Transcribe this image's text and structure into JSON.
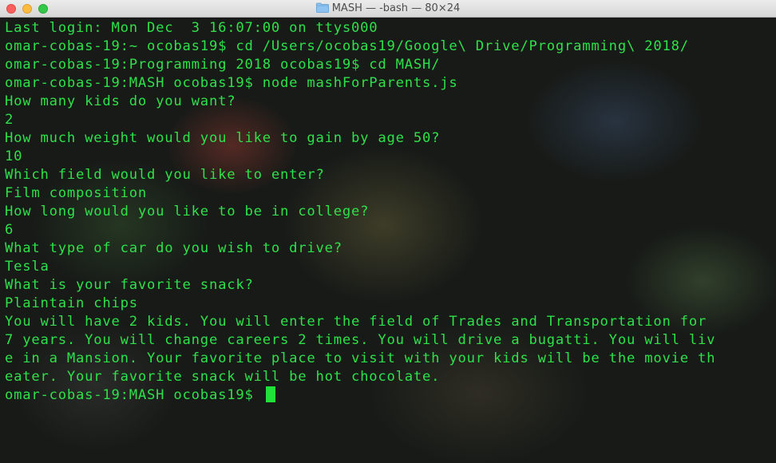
{
  "window": {
    "title": "MASH — -bash — 80×24"
  },
  "terminal": {
    "lines": [
      "Last login: Mon Dec  3 16:07:00 on ttys000",
      "omar-cobas-19:~ ocobas19$ cd /Users/ocobas19/Google\\ Drive/Programming\\ 2018/",
      "omar-cobas-19:Programming 2018 ocobas19$ cd MASH/",
      "omar-cobas-19:MASH ocobas19$ node mashForParents.js",
      "How many kids do you want?",
      "2",
      "How much weight would you like to gain by age 50?",
      "10",
      "Which field would you like to enter?",
      "Film composition",
      "How long would you like to be in college?",
      "6",
      "What type of car do you wish to drive?",
      "Tesla",
      "What is your favorite snack?",
      "Plaintain chips",
      "You will have 2 kids. You will enter the field of Trades and Transportation for",
      "7 years. You will change careers 2 times. You will drive a bugatti. You will liv",
      "e in a Mansion. Your favorite place to visit with your kids will be the movie th",
      "eater. Your favorite snack will be hot chocolate.",
      "omar-cobas-19:MASH ocobas19$ "
    ]
  },
  "colors": {
    "text": "#2fe04a",
    "cursor": "#22e03a"
  }
}
